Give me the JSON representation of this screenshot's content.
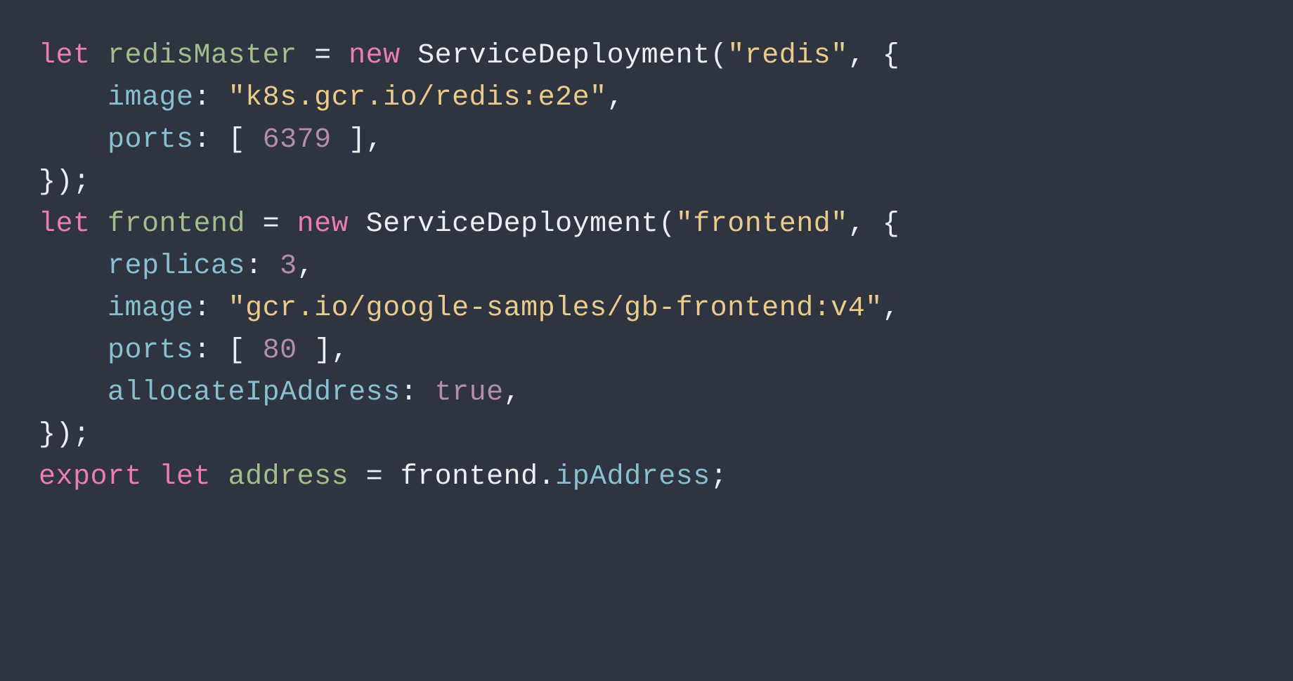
{
  "code": {
    "line1": {
      "let": "let",
      "varName": "redisMaster",
      "equals": " = ",
      "new": "new",
      "class": "ServiceDeployment",
      "openParen": "(",
      "arg1": "\"redis\"",
      "comma": ", ",
      "openBrace": "{"
    },
    "line2": {
      "indent": "    ",
      "prop": "image",
      "colon": ": ",
      "value": "\"k8s.gcr.io/redis:e2e\"",
      "comma": ","
    },
    "line3": {
      "indent": "    ",
      "prop": "ports",
      "colon": ": ",
      "openBracket": "[ ",
      "value": "6379",
      "closeBracket": " ]",
      "comma": ","
    },
    "line4": {
      "closeBrace": "});"
    },
    "line5": {
      "let": "let",
      "varName": "frontend",
      "equals": " = ",
      "new": "new",
      "class": "ServiceDeployment",
      "openParen": "(",
      "arg1": "\"frontend\"",
      "comma": ", ",
      "openBrace": "{"
    },
    "line6": {
      "indent": "    ",
      "prop": "replicas",
      "colon": ": ",
      "value": "3",
      "comma": ","
    },
    "line7": {
      "indent": "    ",
      "prop": "image",
      "colon": ": ",
      "value": "\"gcr.io/google-samples/gb-frontend:v4\"",
      "comma": ","
    },
    "line8": {
      "indent": "    ",
      "prop": "ports",
      "colon": ": ",
      "openBracket": "[ ",
      "value": "80",
      "closeBracket": " ]",
      "comma": ","
    },
    "line9": {
      "indent": "    ",
      "prop": "allocateIpAddress",
      "colon": ": ",
      "value": "true",
      "comma": ","
    },
    "line10": {
      "closeBrace": "});"
    },
    "line11": {
      "export": "export",
      "space1": " ",
      "let": "let",
      "space2": " ",
      "varName": "address",
      "equals": " = ",
      "obj": "frontend",
      "dot": ".",
      "prop": "ipAddress",
      "semi": ";"
    }
  }
}
